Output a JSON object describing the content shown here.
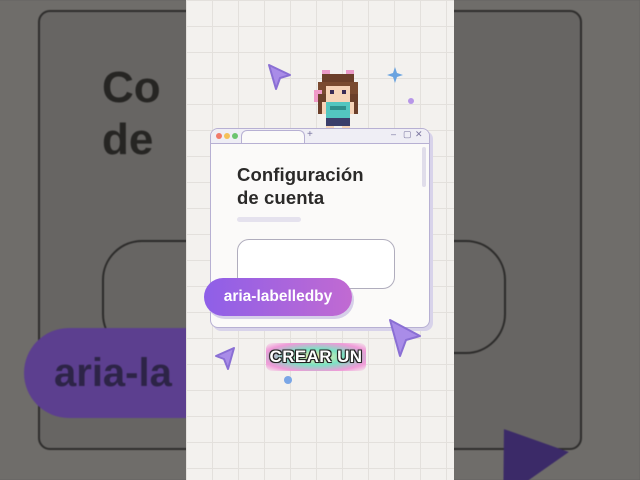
{
  "background": {
    "title_fragment_line1": "Co",
    "title_fragment_line2": "de",
    "pill_fragment": "aria-la"
  },
  "window": {
    "tab_plus": "+",
    "title_line1": "Configuración",
    "title_line2": "de cuenta",
    "traffic_lights": [
      "#f07a6a",
      "#f4c15a",
      "#6cc46f"
    ]
  },
  "badge": {
    "label": "aria-labelledby"
  },
  "caption": {
    "text": "CREAR UN"
  },
  "icons": [
    "cursor-arrow-icon",
    "sparkle-icon",
    "pixel-character-icon",
    "minimize-icon",
    "maximize-icon",
    "close-icon"
  ],
  "colors": {
    "accent_purple": "#9b6ce8",
    "badge_gradient_start": "#8e5fe8",
    "badge_gradient_end": "#c16ad2",
    "stage_background": "#f3f1ee"
  }
}
